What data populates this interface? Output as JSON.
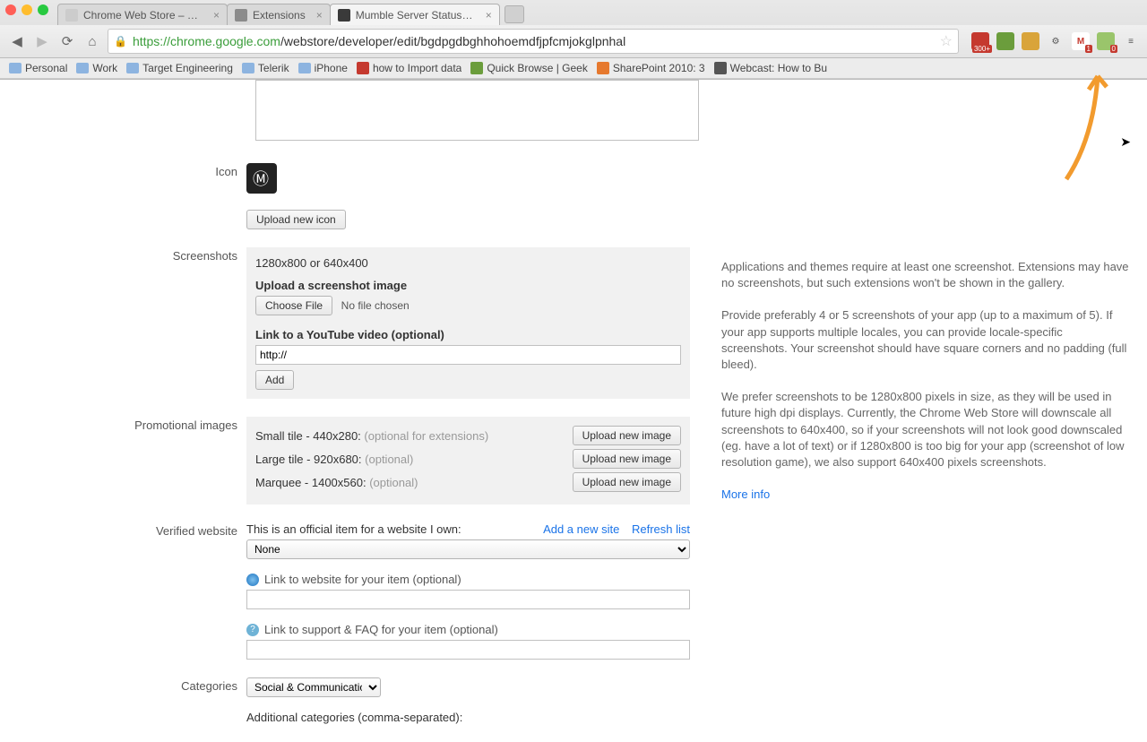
{
  "chrome": {
    "tabs": [
      {
        "label": "Chrome Web Store – mumbl"
      },
      {
        "label": "Extensions"
      },
      {
        "label": "Mumble Server Status – Edit"
      }
    ],
    "url_host": "https://chrome.google.com",
    "url_path": "/webstore/developer/edit/bgdpgdbghhohoemdfjpfcmjokglpnhal"
  },
  "bookmarks": [
    "Personal",
    "Work",
    "Target Engineering",
    "Telerik",
    "iPhone",
    "how to Import data",
    "Quick Browse | Geek",
    "SharePoint 2010: 3",
    "Webcast: How to Bu"
  ],
  "ext_badges": {
    "red_count": "300+",
    "gmail_count": "1",
    "last_count": "0"
  },
  "sections": {
    "icon": {
      "label": "Icon",
      "upload_btn": "Upload new icon"
    },
    "screenshots": {
      "label": "Screenshots",
      "size_hint": "1280x800 or 640x400",
      "upload_title": "Upload a screenshot image",
      "choose_btn": "Choose File",
      "no_file": "No file chosen",
      "yt_title": "Link to a YouTube video (optional)",
      "yt_value": "http://",
      "add_btn": "Add"
    },
    "promo": {
      "label": "Promotional images",
      "rows": [
        {
          "text": "Small tile - 440x280:",
          "opt": "(optional for extensions)"
        },
        {
          "text": "Large tile - 920x680:",
          "opt": "(optional)"
        },
        {
          "text": "Marquee - 1400x560:",
          "opt": "(optional)"
        }
      ],
      "upload_btn": "Upload new image"
    },
    "verified": {
      "label": "Verified website",
      "intro": "This is an official item for a website I own:",
      "add_link": "Add a new site",
      "refresh_link": "Refresh list",
      "select_value": "None",
      "website_label": "Link to website for your item (optional)",
      "support_label": "Link to support & FAQ for your item (optional)"
    },
    "categories": {
      "label": "Categories",
      "select_value": "Social & Communication",
      "additional_label": "Additional categories (comma-separated):"
    }
  },
  "help": {
    "p1": "Applications and themes require at least one screenshot. Extensions may have no screenshots, but such extensions won't be shown in the gallery.",
    "p2": "Provide preferably 4 or 5 screenshots of your app (up to a maximum of 5). If your app supports multiple locales, you can provide locale-specific screenshots. Your screenshot should have square corners and no padding (full bleed).",
    "p3": "We prefer screenshots to be 1280x800 pixels in size, as they will be used in future high dpi displays. Currently, the Chrome Web Store will downscale all screenshots to 640x400, so if your screenshots will not look good downscaled (eg. have a lot of text) or if 1280x800 is too big for your app (screenshot of low resolution game), we also support 640x400 pixels screenshots.",
    "more": "More info"
  }
}
